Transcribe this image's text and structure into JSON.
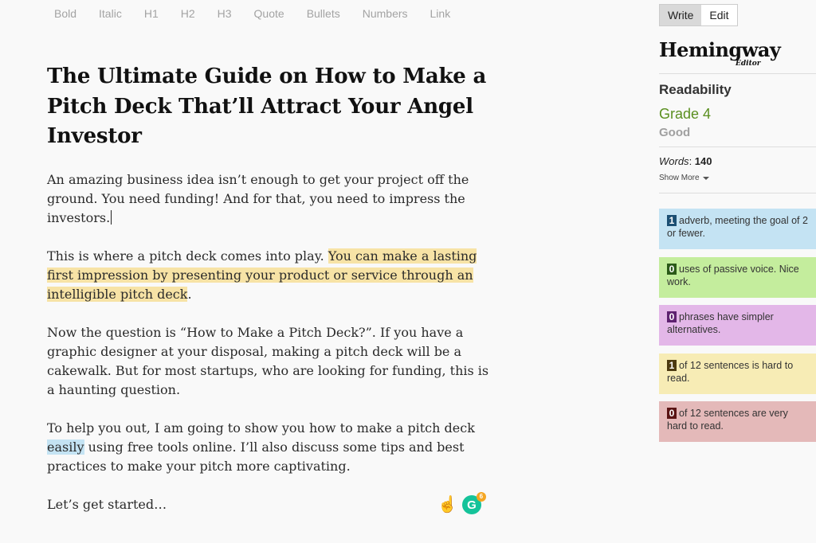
{
  "toolbar": {
    "bold": "Bold",
    "italic": "Italic",
    "h1": "H1",
    "h2": "H2",
    "h3": "H3",
    "quote": "Quote",
    "bullets": "Bullets",
    "numbers": "Numbers",
    "link": "Link"
  },
  "document": {
    "title": "The Ultimate Guide on How to Make a Pitch Deck That’ll Attract Your Angel Investor",
    "p1": "An amazing business idea isn’t enough to get your project off the ground. You need funding! And for that, you need to impress the investors.",
    "p2_plain": "This is where a pitch deck comes into play. ",
    "p2_highlight": "You can make a lasting first impression by presenting your product or service through an intelligible pitch deck",
    "p2_end": ".",
    "p3": "Now the question is “How to Make a Pitch Deck?”. If you have a graphic designer at your disposal, making a pitch deck will be a cakewalk. But for most startups, who are looking for funding, this is a haunting question.",
    "p4_start": "To help you out, I am going to show you how to make a pitch deck ",
    "p4_adverb": "easily",
    "p4_end": " using free tools online. I’ll also discuss some tips and best practices to make your pitch more captivating.",
    "p5": "Let’s get started…"
  },
  "bottom_icons": {
    "finger": "☝",
    "grammarly_letter": "G",
    "grammarly_count": "6"
  },
  "sidebar": {
    "mode_write": "Write",
    "mode_edit": "Edit",
    "brand": "Hemingway",
    "brand_sub": "Editor",
    "readability_label": "Readability",
    "grade": "Grade 4",
    "grade_desc": "Good",
    "words_label": "Words",
    "words_value": "140",
    "show_more": "Show More",
    "cards": {
      "adverb_num": "1",
      "adverb_text": "adverb, meeting the goal of 2 or fewer.",
      "passive_num": "0",
      "passive_text": "uses of passive voice. Nice work.",
      "simpler_num": "0",
      "simpler_text": "phrases have simpler alternatives.",
      "hard_num": "1",
      "hard_text": "of 12 sentences is hard to read.",
      "vhard_num": "0",
      "vhard_text": "of 12 sentences are very hard to read."
    }
  },
  "colors": {
    "adverb": "#c4e3f3",
    "passive": "#c4ed9d",
    "simpler": "#e3b7e8",
    "hard": "#f7ecb5",
    "very_hard": "#e4b9b9",
    "grade": "#5a8f1f"
  }
}
